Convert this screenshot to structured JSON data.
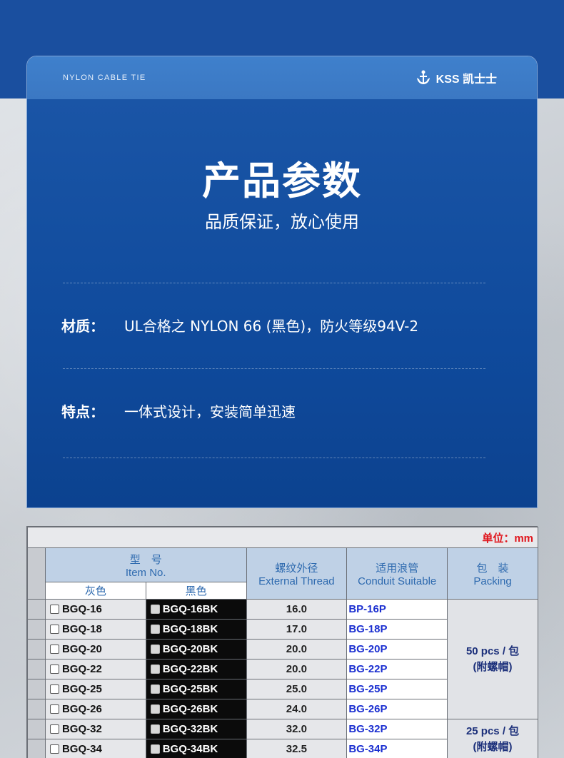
{
  "header": {
    "subtitle_en": "NYLON CABLE TIE",
    "brand": "KSS 凯士士",
    "brand_icon": "anchor-logo-icon"
  },
  "hero": {
    "title": "产品参数",
    "subtitle": "品质保证，放心使用"
  },
  "specs": [
    {
      "key": "材质：",
      "value": "UL合格之 NYLON 66 (黑色)，防火等级94V-2"
    },
    {
      "key": "特点：",
      "value": "一体式设计，安装简单迅速"
    }
  ],
  "table": {
    "unit": "单位：mm",
    "headers": {
      "item_cn": "型　号",
      "item_en": "Item No.",
      "gray": "灰色",
      "black": "黑色",
      "thread_cn": "螺纹外径",
      "thread_en": "External Thread",
      "conduit_cn": "适用浪管",
      "conduit_en": "Conduit Suitable",
      "pack_cn": "包　装",
      "pack_en": "Packing"
    },
    "rows": [
      {
        "gray": "BGQ-16",
        "black": "BGQ-16BK",
        "thread": "16.0",
        "conduit": "BP-16P"
      },
      {
        "gray": "BGQ-18",
        "black": "BGQ-18BK",
        "thread": "17.0",
        "conduit": "BG-18P"
      },
      {
        "gray": "BGQ-20",
        "black": "BGQ-20BK",
        "thread": "20.0",
        "conduit": "BG-20P"
      },
      {
        "gray": "BGQ-22",
        "black": "BGQ-22BK",
        "thread": "20.0",
        "conduit": "BG-22P"
      },
      {
        "gray": "BGQ-25",
        "black": "BGQ-25BK",
        "thread": "25.0",
        "conduit": "BG-25P"
      },
      {
        "gray": "BGQ-26",
        "black": "BGQ-26BK",
        "thread": "24.0",
        "conduit": "BG-26P"
      },
      {
        "gray": "BGQ-32",
        "black": "BGQ-32BK",
        "thread": "32.0",
        "conduit": "BG-32P"
      },
      {
        "gray": "BGQ-34",
        "black": "BGQ-34BK",
        "thread": "32.5",
        "conduit": "BG-34P"
      }
    ],
    "packing": [
      {
        "line1": "50 pcs / 包",
        "line2": "(附螺帽)"
      },
      {
        "line1": "25 pcs / 包",
        "line2": "(附螺帽)"
      }
    ]
  },
  "colors": {
    "brand_blue": "#0f4ea5",
    "header_blue": "#3f80cc",
    "unit_red": "#e0141b",
    "conduit_blue": "#1b2fd0"
  }
}
